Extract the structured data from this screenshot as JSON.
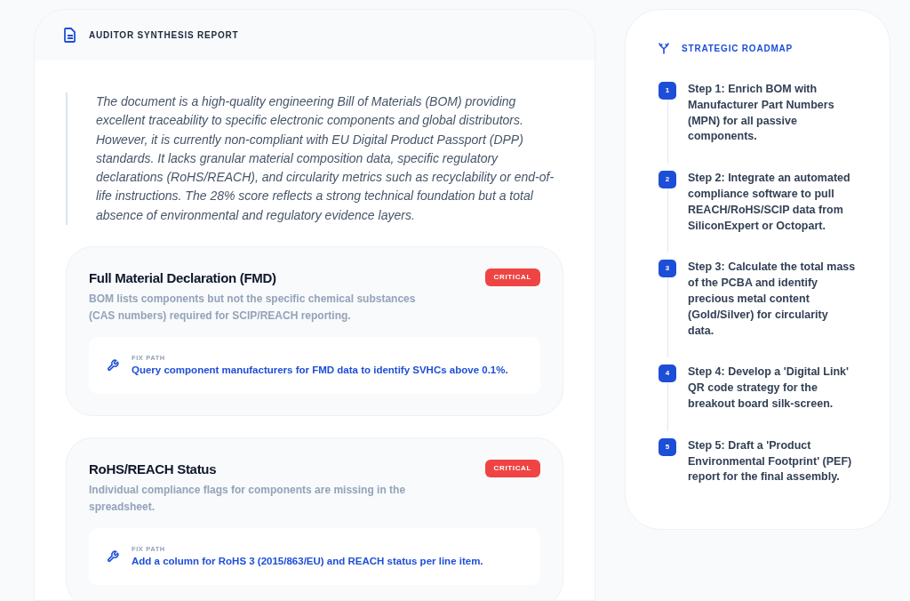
{
  "report": {
    "title": "AUDITOR SYNTHESIS REPORT",
    "summary": "The document is a high-quality engineering Bill of Materials (BOM) providing excellent traceability to specific electronic components and global distributors. However, it is currently non-compliant with EU Digital Product Passport (DPP) standards. It lacks granular material composition data, specific regulatory declarations (RoHS/REACH), and circularity metrics such as recyclability or end-of-life instructions. The 28% score reflects a strong technical foundation but a total absence of environmental and regulatory evidence layers.",
    "findings": [
      {
        "title": "Full Material Declaration (FMD)",
        "color": "#ef4444",
        "badge": "CRITICAL",
        "description": "BOM lists components but not the specific chemical substances (CAS numbers) required for SCIP/REACH reporting.",
        "fix_label": "FIX PATH",
        "fix": "Query component manufacturers for FMD data to identify SVHCs above 0.1%."
      },
      {
        "title": "RoHS/REACH Status",
        "color": "#ef4444",
        "badge": "CRITICAL",
        "description": "Individual compliance flags for components are missing in the spreadsheet.",
        "fix_label": "FIX PATH",
        "fix": "Add a column for RoHS 3 (2015/863/EU) and REACH status per line item."
      }
    ]
  },
  "roadmap": {
    "title": "STRATEGIC ROADMAP",
    "steps": [
      {
        "number": "1",
        "text": "Step 1: Enrich BOM with Manufacturer Part Numbers (MPN) for all passive components."
      },
      {
        "number": "2",
        "text": "Step 2: Integrate an automated compliance software to pull REACH/RoHS/SCIP data from SiliconExpert or Octopart."
      },
      {
        "number": "3",
        "text": "Step 3: Calculate the total mass of the PCBA and identify precious metal content (Gold/Silver) for circularity data."
      },
      {
        "number": "4",
        "text": "Step 4: Develop a 'Digital Link' QR code strategy for the breakout board silk-screen."
      },
      {
        "number": "5",
        "text": "Step 5: Draft a 'Product Environmental Footprint' (PEF) report for the final assembly."
      }
    ]
  }
}
